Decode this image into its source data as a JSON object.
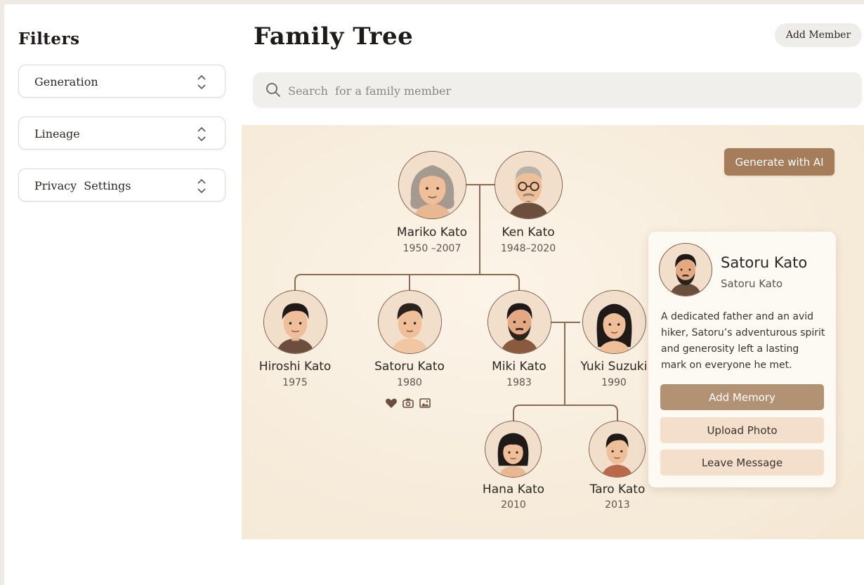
{
  "sidebar": {
    "title": "Filters",
    "filters": [
      {
        "label": "Generation"
      },
      {
        "label": "Lineage"
      },
      {
        "label": "Privacy  Settings"
      }
    ]
  },
  "header": {
    "title": "Family Tree",
    "add_member_label": "Add Member"
  },
  "search": {
    "placeholder": "Search  for a family member",
    "value": ""
  },
  "tree": {
    "generate_label": "Generate with AI",
    "people": {
      "mariko": {
        "name": "Mariko Kato",
        "years": "1950 –2007"
      },
      "ken": {
        "name": "Ken Kato",
        "years": "1948–2020"
      },
      "hiroshi": {
        "name": "Hiroshi Kato",
        "years": "1975"
      },
      "satoru": {
        "name": "Satoru Kato",
        "years": "1980"
      },
      "miki": {
        "name": "Miki  Kato",
        "years": "1983"
      },
      "yuki": {
        "name": "Yuki Suzuki",
        "years": "1990"
      },
      "hana": {
        "name": "Hana Kato",
        "years": "2010"
      },
      "taro": {
        "name": "Taro Kato",
        "years": "2013"
      }
    },
    "satoru_icons": [
      "heart-icon",
      "camera-icon",
      "photo-icon"
    ]
  },
  "detail_card": {
    "name": "Satoru Kato",
    "subtitle": "Satoru Kato",
    "bio": "A dedicated father and an avid hiker, Satoru’s adventurous spirit and generosity left a lasting mark on everyone he met.",
    "buttons": {
      "add_memory": "Add Memory",
      "upload_photo": "Upload Photo",
      "leave_message": "Leave Message"
    }
  },
  "colors": {
    "accent": "#a57d5b",
    "primary_button": "#b39274",
    "secondary_button": "#f3dfcc",
    "canvas_bg": "#f7ecdb",
    "connector": "#8a6a50"
  }
}
